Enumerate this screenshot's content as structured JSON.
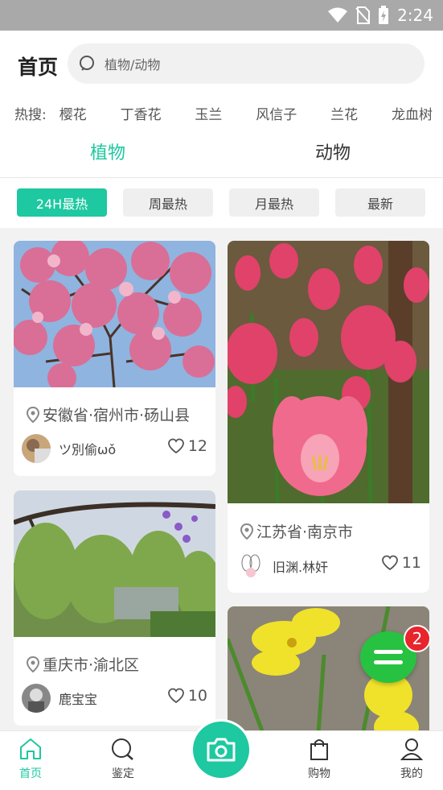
{
  "status_bar": {
    "time": "2:24"
  },
  "header": {
    "title": "首页",
    "search_placeholder": "植物/动物"
  },
  "hot_search": {
    "label": "热搜:",
    "items": [
      "樱花",
      "丁香花",
      "玉兰",
      "风信子",
      "兰花",
      "龙血树"
    ]
  },
  "category_tabs": [
    {
      "label": "植物",
      "active": true
    },
    {
      "label": "动物",
      "active": false
    }
  ],
  "filters": [
    {
      "label": "24H最热",
      "active": true
    },
    {
      "label": "周最热",
      "active": false
    },
    {
      "label": "月最热",
      "active": false
    },
    {
      "label": "最新",
      "active": false
    }
  ],
  "cards": [
    {
      "location": "安徽省·宿州市·砀山县",
      "user": "ツ別偷ωǒ",
      "likes": "12",
      "photo": "pink cherry blossom tree"
    },
    {
      "location": "江苏省·南京市",
      "user": "旧渊.林奸",
      "likes": "11",
      "photo": "pink tulips"
    },
    {
      "location": "重庆市·渝北区",
      "user": "鹿宝宝",
      "likes": "10",
      "photo": "willow tree by pond"
    },
    {
      "photo": "yellow evening primrose"
    }
  ],
  "fab": {
    "badge": "2"
  },
  "bottom_nav": [
    {
      "label": "首页",
      "icon": "home-icon",
      "active": true
    },
    {
      "label": "鉴定",
      "icon": "identify-search-icon",
      "active": false
    },
    {
      "label": "购物",
      "icon": "shopping-bag-icon",
      "active": false
    },
    {
      "label": "我的",
      "icon": "profile-icon",
      "active": false
    }
  ],
  "colors": {
    "accent": "#1ec8a0",
    "fab_green": "#27c241",
    "badge_red": "#e8242c"
  }
}
